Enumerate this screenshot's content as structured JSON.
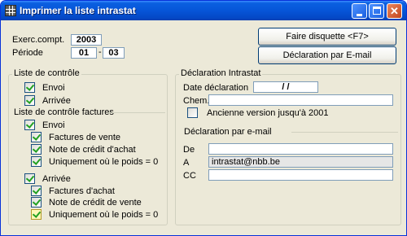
{
  "window": {
    "title": "Imprimer la liste intrastat"
  },
  "exercise": {
    "label": "Exerc.compt.",
    "value": "2003"
  },
  "period": {
    "label": "Période",
    "from": "01",
    "sep": "-",
    "to": "03"
  },
  "buttons": {
    "floppy": "Faire disquette <F7>",
    "email": "Déclaration par E-mail"
  },
  "checklist": {
    "title": "Liste de contrôle",
    "envoi": {
      "label": "Envoi",
      "checked": true
    },
    "arrivee": {
      "label": "Arrivée",
      "checked": true
    }
  },
  "invoice_checklist": {
    "title": "Liste de contrôle factures",
    "envoi": {
      "label": "Envoi",
      "checked": true,
      "items": [
        {
          "label": "Factures de vente",
          "checked": true
        },
        {
          "label": "Note de crédit d'achat",
          "checked": true
        },
        {
          "label": "Uniquement où le poids = 0",
          "checked": true
        }
      ]
    },
    "arrivee": {
      "label": "Arrivée",
      "checked": true,
      "items": [
        {
          "label": "Factures d'achat",
          "checked": true
        },
        {
          "label": "Note de crédit de vente",
          "checked": true
        },
        {
          "label": "Uniquement où le poids = 0",
          "checked": true
        }
      ]
    }
  },
  "intrastat": {
    "title": "Déclaration Intrastat",
    "date_label": "Date déclaration",
    "date_value": "/ /",
    "path_label": "Chem.",
    "path_value": "",
    "old_version_label": "Ancienne version jusqu'à 2001",
    "old_version_checked": false
  },
  "email_decl": {
    "title": "Déclaration par e-mail",
    "from_label": "De",
    "from_value": "",
    "to_label": "A",
    "to_value": "intrastat@nbb.be",
    "cc_label": "CC",
    "cc_value": ""
  }
}
